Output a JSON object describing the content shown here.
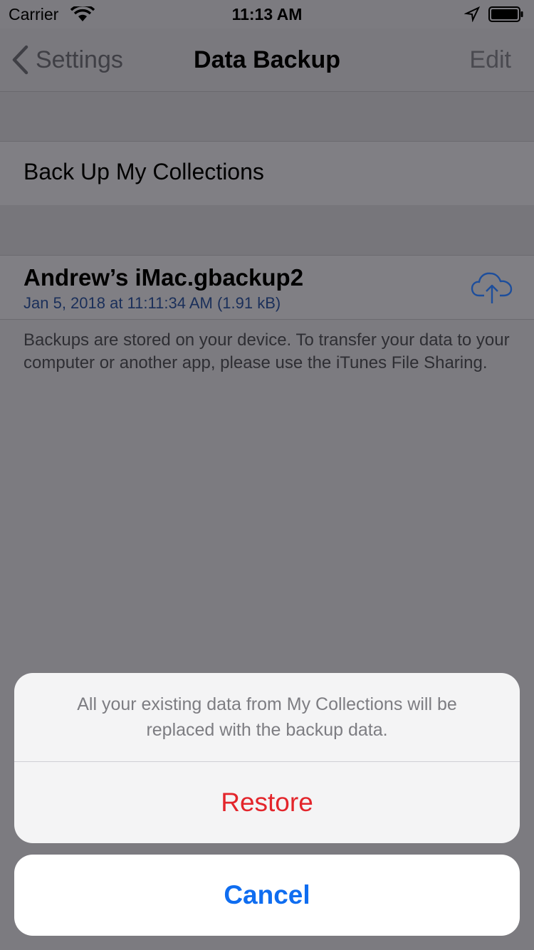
{
  "status_bar": {
    "carrier": "Carrier",
    "time": "11:13 AM"
  },
  "nav": {
    "back_label": "Settings",
    "title": "Data Backup",
    "edit_label": "Edit"
  },
  "backup_action": {
    "label": "Back Up My Collections"
  },
  "file": {
    "name": "Andrew’s iMac.gbackup2",
    "meta": "Jan 5, 2018 at 11:11:34 AM (1.91 kB)",
    "icon": "cloud-upload-icon"
  },
  "footer": {
    "text": "Backups are stored on your device. To transfer your data to your computer or another app, please use the iTunes File Sharing."
  },
  "action_sheet": {
    "message": "All your existing data from My Collections will be replaced with the backup data.",
    "restore_label": "Restore",
    "cancel_label": "Cancel"
  },
  "colors": {
    "destructive": "#e3252b",
    "tint": "#0f6df0",
    "dim_overlay": "#7c7b80"
  }
}
